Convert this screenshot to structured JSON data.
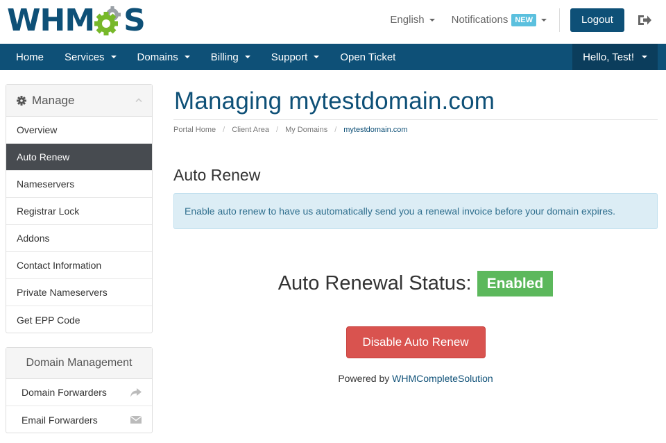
{
  "brand": {
    "logo_left": "WHM",
    "logo_right": "S",
    "logo_color": "#0e5077",
    "gear_colors": [
      "#77b82a",
      "#9aa0a6"
    ]
  },
  "topbar": {
    "language": "English",
    "notifications": "Notifications",
    "notifications_badge": "NEW",
    "logout": "Logout"
  },
  "navbar": {
    "items": [
      {
        "label": "Home",
        "dropdown": false
      },
      {
        "label": "Services",
        "dropdown": true
      },
      {
        "label": "Domains",
        "dropdown": true
      },
      {
        "label": "Billing",
        "dropdown": true
      },
      {
        "label": "Support",
        "dropdown": true
      },
      {
        "label": "Open Ticket",
        "dropdown": false
      }
    ],
    "user": "Hello, Test!",
    "bg_color": "#0e5077"
  },
  "sidebar": {
    "manage": {
      "title": "Manage",
      "items": [
        {
          "label": "Overview",
          "active": false
        },
        {
          "label": "Auto Renew",
          "active": true
        },
        {
          "label": "Nameservers",
          "active": false
        },
        {
          "label": "Registrar Lock",
          "active": false
        },
        {
          "label": "Addons",
          "active": false
        },
        {
          "label": "Contact Information",
          "active": false
        },
        {
          "label": "Private Nameservers",
          "active": false
        },
        {
          "label": "Get EPP Code",
          "active": false
        }
      ]
    },
    "domain_management": {
      "title": "Domain Management",
      "items": [
        {
          "label": "Domain Forwarders",
          "icon": "share-icon"
        },
        {
          "label": "Email Forwarders",
          "icon": "envelope-icon"
        }
      ]
    }
  },
  "main": {
    "title": "Managing mytestdomain.com",
    "breadcrumb": [
      "Portal Home",
      "Client Area",
      "My Domains",
      "mytestdomain.com"
    ],
    "section_title": "Auto Renew",
    "info_text": "Enable auto renew to have us automatically send you a renewal invoice before your domain expires.",
    "status_label": "Auto Renewal Status:",
    "status_value": "Enabled",
    "status_color": "#5cb85c",
    "disable_button": "Disable Auto Renew",
    "disable_button_color": "#d9534f",
    "powered_by_prefix": "Powered by",
    "powered_by_link": "WHMCompleteSolution"
  }
}
